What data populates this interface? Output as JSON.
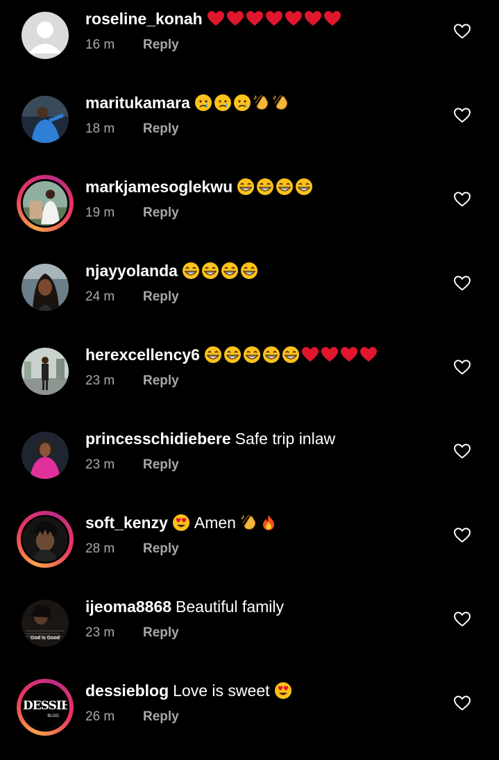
{
  "reply_label": "Reply",
  "comments": [
    {
      "username": "roseline_konah",
      "text": "",
      "emojis": [
        "heart",
        "heart",
        "heart",
        "heart",
        "heart",
        "heart",
        "heart"
      ],
      "time": "16 m",
      "avatar": "placeholder",
      "story_ring": false
    },
    {
      "username": "maritukamara",
      "text": "",
      "emojis": [
        "cry",
        "cry",
        "cry",
        "clap",
        "clap"
      ],
      "time": "18 m",
      "avatar": "photo-blue",
      "story_ring": false
    },
    {
      "username": "markjamesoglekwu",
      "text": "",
      "emojis": [
        "grin",
        "grin",
        "grin",
        "grin"
      ],
      "time": "19 m",
      "avatar": "photo-outdoor",
      "story_ring": true
    },
    {
      "username": "njayyolanda",
      "text": "",
      "emojis": [
        "grin",
        "grin",
        "grin",
        "grin"
      ],
      "time": "24 m",
      "avatar": "photo-portrait",
      "story_ring": false
    },
    {
      "username": "herexcellency6",
      "text": "",
      "emojis": [
        "grin",
        "grin",
        "grin",
        "grin",
        "grin",
        "heart",
        "heart",
        "heart",
        "heart"
      ],
      "time": "23 m",
      "avatar": "photo-street",
      "story_ring": false
    },
    {
      "username": "princesschidiebere",
      "text": "Safe trip inlaw",
      "emojis": [],
      "time": "23 m",
      "avatar": "photo-pink",
      "story_ring": false
    },
    {
      "username": "soft_kenzy",
      "text": "",
      "emojis": [
        "heart-eyes"
      ],
      "text_after": "Amen",
      "emojis_after": [
        "clap",
        "fire"
      ],
      "time": "28 m",
      "avatar": "photo-dreads",
      "story_ring": true
    },
    {
      "username": "ijeoma8868",
      "text": "Beautiful family",
      "emojis": [],
      "time": "23 m",
      "avatar": "photo-dark",
      "story_ring": false,
      "avatar_caption": "God is Good"
    },
    {
      "username": "dessieblog",
      "text": "Love is sweet",
      "emojis": [
        "heart-eyes"
      ],
      "time": "26 m",
      "avatar": "logo-dessie",
      "story_ring": true,
      "avatar_logo_text": "DESSIE",
      "avatar_logo_sub": "BLOG"
    }
  ]
}
